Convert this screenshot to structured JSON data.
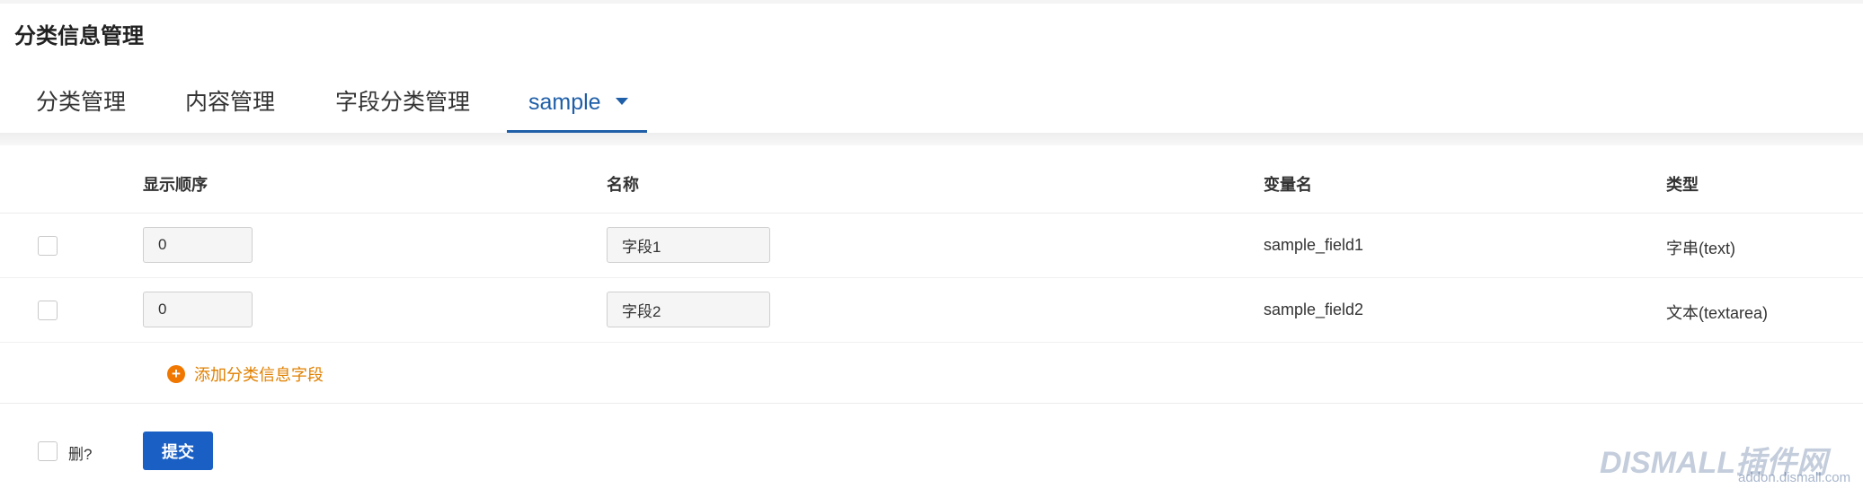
{
  "page": {
    "title": "分类信息管理"
  },
  "tabs": [
    {
      "label": "分类管理",
      "active": false
    },
    {
      "label": "内容管理",
      "active": false
    },
    {
      "label": "字段分类管理",
      "active": false
    },
    {
      "label": "sample",
      "active": true
    }
  ],
  "table": {
    "headers": {
      "order": "显示顺序",
      "name": "名称",
      "variable": "变量名",
      "type": "类型"
    },
    "rows": [
      {
        "order": "0",
        "name": "字段1",
        "variable": "sample_field1",
        "type": "字串(text)",
        "checked": false
      },
      {
        "order": "0",
        "name": "字段2",
        "variable": "sample_field2",
        "type": "文本(textarea)",
        "checked": false
      }
    ]
  },
  "actions": {
    "add_field_label": "添加分类信息字段",
    "delete_label": "删?",
    "submit_label": "提交"
  },
  "watermark": {
    "logo_text": "DISMALL插件网",
    "url": "addon.dismall.com"
  },
  "colors": {
    "accent": "#1f5fa8",
    "submit": "#1a5fc4",
    "add_link": "#e08000"
  }
}
